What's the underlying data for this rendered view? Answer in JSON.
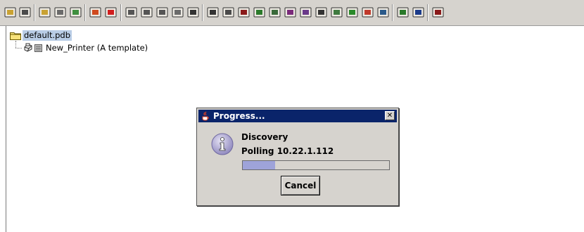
{
  "toolbar": {
    "buttons": [
      {
        "name": "open-folder-icon"
      },
      {
        "name": "save-icon"
      },
      {
        "name": "new-item-icon"
      },
      {
        "name": "new-printer-icon"
      },
      {
        "name": "new-document-icon"
      },
      {
        "name": "wand-icon"
      },
      {
        "name": "stop-icon"
      },
      {
        "name": "cut-icon"
      },
      {
        "name": "copy-icon"
      },
      {
        "name": "paste-icon"
      },
      {
        "name": "paste-special-icon"
      },
      {
        "name": "delete-icon"
      },
      {
        "name": "device-icon"
      },
      {
        "name": "printer-config-icon"
      },
      {
        "name": "report-icon"
      },
      {
        "name": "network-icon"
      },
      {
        "name": "print-icon"
      },
      {
        "name": "scan-icon"
      },
      {
        "name": "config-icon"
      },
      {
        "name": "panel-icon"
      },
      {
        "name": "queue-icon"
      },
      {
        "name": "topology-icon"
      },
      {
        "name": "refresh-icon"
      },
      {
        "name": "device-status-icon"
      },
      {
        "name": "flag-icon"
      },
      {
        "name": "tools-icon"
      },
      {
        "name": "percent-icon"
      }
    ]
  },
  "tree": {
    "root_label": "default.pdb",
    "child_label": "New_Printer (A template)"
  },
  "dialog": {
    "title": "Progress...",
    "close_glyph": "✕",
    "message": "Discovery",
    "status": "Polling 10.22.1.112",
    "progress_fraction": 0.22,
    "cancel_label": "Cancel"
  }
}
